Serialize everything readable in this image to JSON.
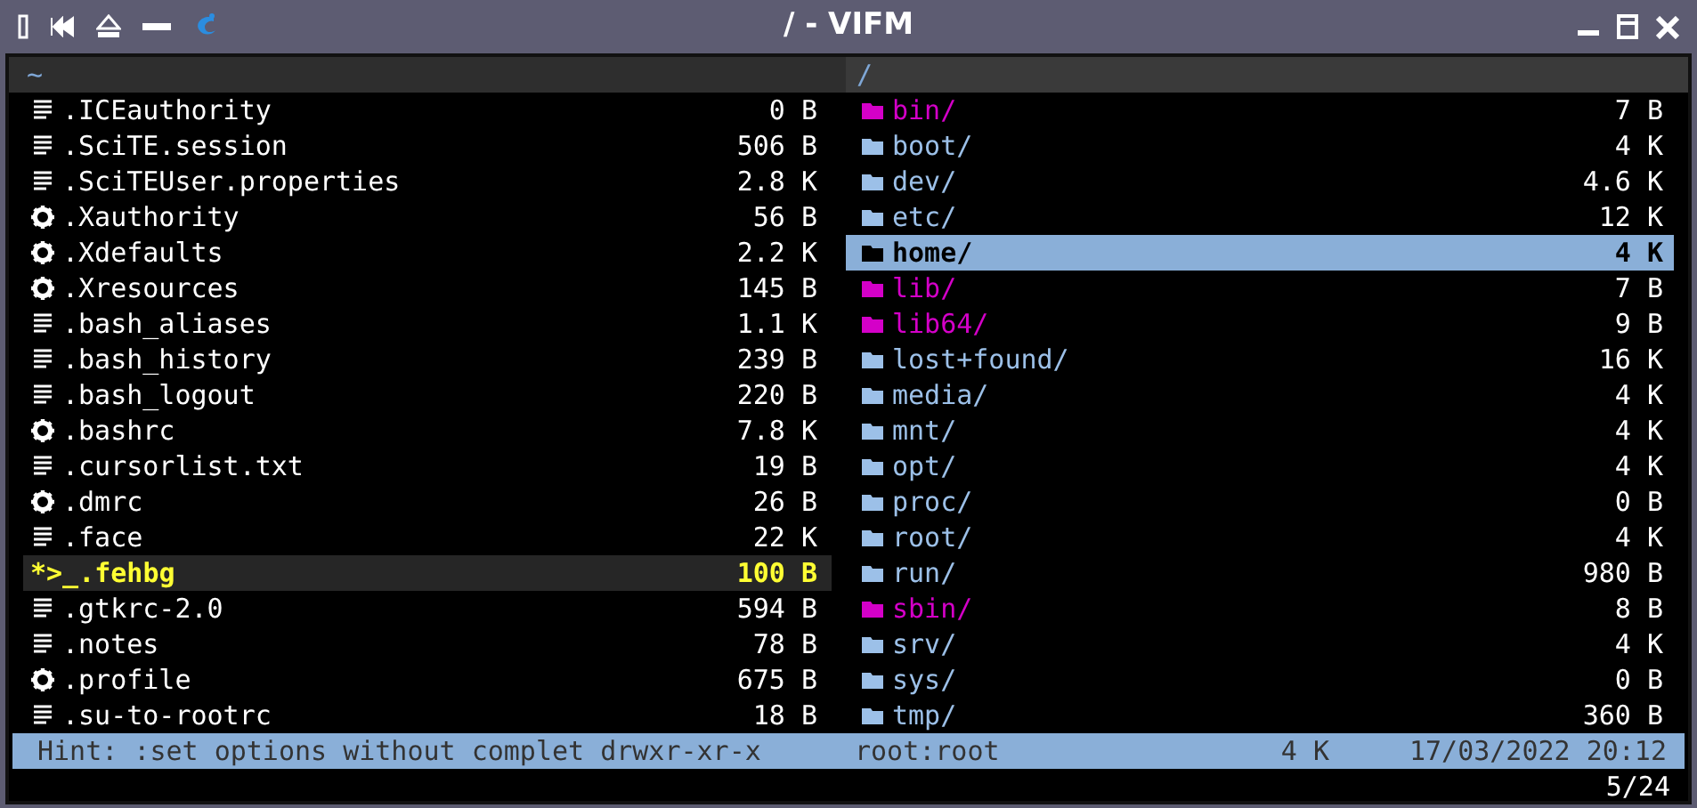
{
  "window": {
    "title": "/ - VIFM"
  },
  "left_pane": {
    "path": "~",
    "items": [
      {
        "kind": "file",
        "name": ".ICEauthority",
        "size": "0 B",
        "selected": false
      },
      {
        "kind": "file",
        "name": ".SciTE.session",
        "size": "506 B",
        "selected": false
      },
      {
        "kind": "file",
        "name": ".SciTEUser.properties",
        "size": "2.8 K",
        "selected": false
      },
      {
        "kind": "config",
        "name": ".Xauthority",
        "size": "56 B",
        "selected": false
      },
      {
        "kind": "config",
        "name": ".Xdefaults",
        "size": "2.2 K",
        "selected": false
      },
      {
        "kind": "config",
        "name": ".Xresources",
        "size": "145 B",
        "selected": false
      },
      {
        "kind": "file",
        "name": ".bash_aliases",
        "size": "1.1 K",
        "selected": false
      },
      {
        "kind": "file",
        "name": ".bash_history",
        "size": "239 B",
        "selected": false
      },
      {
        "kind": "file",
        "name": ".bash_logout",
        "size": "220 B",
        "selected": false
      },
      {
        "kind": "config",
        "name": ".bashrc",
        "size": "7.8 K",
        "selected": false
      },
      {
        "kind": "file",
        "name": ".cursorlist.txt",
        "size": "19 B",
        "selected": false
      },
      {
        "kind": "config",
        "name": ".dmrc",
        "size": "26 B",
        "selected": false
      },
      {
        "kind": "file",
        "name": ".face",
        "size": "22 K",
        "selected": false
      },
      {
        "kind": "executable",
        "icon": "*>_",
        "name": ".fehbg",
        "size": "100 B",
        "selected": true
      },
      {
        "kind": "file",
        "name": ".gtkrc-2.0",
        "size": "594 B",
        "selected": false
      },
      {
        "kind": "file",
        "name": ".notes",
        "size": "78 B",
        "selected": false
      },
      {
        "kind": "config",
        "name": ".profile",
        "size": "675 B",
        "selected": false
      },
      {
        "kind": "file",
        "name": ".su-to-rootrc",
        "size": "18 B",
        "selected": false
      }
    ]
  },
  "right_pane": {
    "path": "/",
    "items": [
      {
        "kind": "link",
        "name": "bin/",
        "size": "7 B",
        "selected": false
      },
      {
        "kind": "dir",
        "name": "boot/",
        "size": "4 K",
        "selected": false
      },
      {
        "kind": "dir",
        "name": "dev/",
        "size": "4.6 K",
        "selected": false
      },
      {
        "kind": "dir",
        "name": "etc/",
        "size": "12 K",
        "selected": false
      },
      {
        "kind": "dir",
        "name": "home/",
        "size": "4 K",
        "selected": true
      },
      {
        "kind": "link",
        "name": "lib/",
        "size": "7 B",
        "selected": false
      },
      {
        "kind": "link",
        "name": "lib64/",
        "size": "9 B",
        "selected": false
      },
      {
        "kind": "dir",
        "name": "lost+found/",
        "size": "16 K",
        "selected": false
      },
      {
        "kind": "dir",
        "name": "media/",
        "size": "4 K",
        "selected": false
      },
      {
        "kind": "dir",
        "name": "mnt/",
        "size": "4 K",
        "selected": false
      },
      {
        "kind": "dir",
        "name": "opt/",
        "size": "4 K",
        "selected": false
      },
      {
        "kind": "dir",
        "name": "proc/",
        "size": "0 B",
        "selected": false
      },
      {
        "kind": "dir",
        "name": "root/",
        "size": "4 K",
        "selected": false
      },
      {
        "kind": "dir",
        "name": "run/",
        "size": "980 B",
        "selected": false
      },
      {
        "kind": "link",
        "name": "sbin/",
        "size": "8 B",
        "selected": false
      },
      {
        "kind": "dir",
        "name": "srv/",
        "size": "4 K",
        "selected": false
      },
      {
        "kind": "dir",
        "name": "sys/",
        "size": "0 B",
        "selected": false
      },
      {
        "kind": "dir",
        "name": "tmp/",
        "size": "360 B",
        "selected": false
      }
    ]
  },
  "status_bar": {
    "hint": "Hint: :set options without complet",
    "permissions": "drwxr-xr-x",
    "owner": "root:root",
    "size": "4 K",
    "modified": "17/03/2022 20:12"
  },
  "position": "5/24"
}
